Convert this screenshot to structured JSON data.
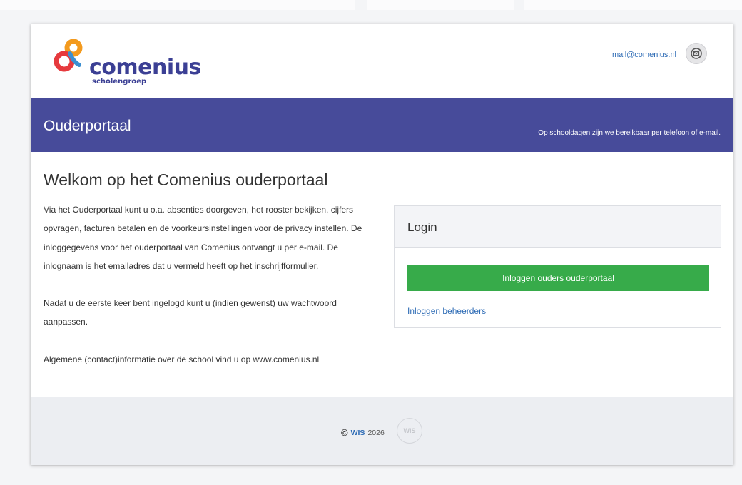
{
  "header": {
    "logo_name": "comenius",
    "logo_sub": "scholengroep",
    "mail_link": "mail@comenius.nl",
    "mail_icon": "envelope-icon"
  },
  "banner": {
    "title": "Ouderportaal",
    "note": "Op schooldagen zijn we bereikbaar per telefoon of e-mail."
  },
  "main": {
    "title": "Welkom op het Comenius ouderportaal",
    "paragraphs": [
      "Via het Ouderportaal kunt u o.a. absenties doorgeven, het rooster bekijken, cijfers opvragen, facturen betalen en de voorkeursinstellingen voor de privacy instellen. De inloggegevens voor het ouderportaal van Comenius ontvangt u per e-mail. De inlognaam is het emailadres dat u vermeld heeft op het inschrijfformulier.",
      "Nadat u de eerste keer bent ingelogd kunt u (indien gewenst) uw wachtwoord aanpassen.",
      "Algemene (contact)informatie over de school vind u op www.comenius.nl"
    ]
  },
  "login": {
    "heading": "Login",
    "parents_button": "Inloggen ouders ouderportaal",
    "admin_link": "Inloggen beheerders"
  },
  "footer": {
    "copyright_symbol": "©",
    "brand": "WIS",
    "year": "2026",
    "logo_text": "WIS"
  },
  "colors": {
    "banner": "#474b9a",
    "brand_text": "#3b3f94",
    "login_button": "#37ab4a",
    "link": "#2d6bb5"
  }
}
